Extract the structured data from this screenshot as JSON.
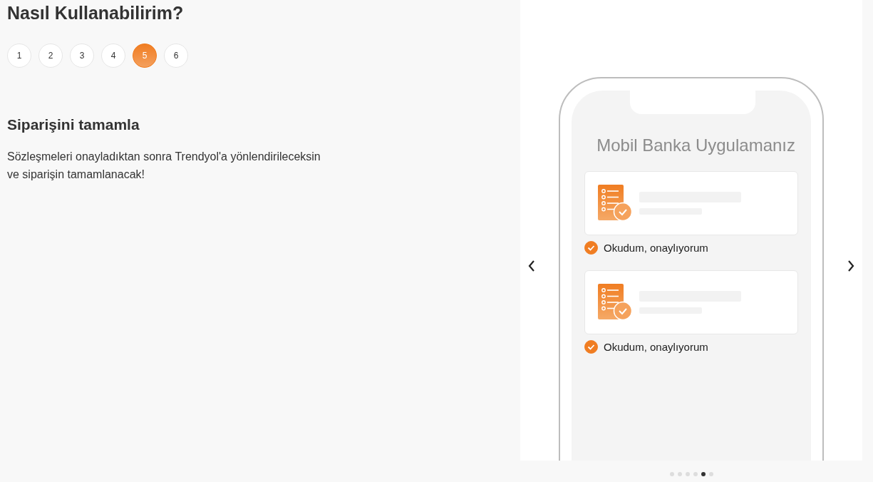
{
  "title": "Nasıl Kullanabilirim?",
  "steps": [
    {
      "label": "1",
      "selected": false
    },
    {
      "label": "2",
      "selected": false
    },
    {
      "label": "3",
      "selected": false
    },
    {
      "label": "4",
      "selected": false
    },
    {
      "label": "5",
      "selected": true
    },
    {
      "label": "6",
      "selected": false
    }
  ],
  "step": {
    "title": "Siparişini tamamla",
    "description": "Sözleşmeleri onayladıktan sonra Trendyol'a yönlendirileceksin\nve siparişin tamamlanacak!"
  },
  "slide": {
    "app_title": "Mobil Banka Uygulamanız",
    "agreements": [
      {
        "label": "Okudum, onaylıyorum",
        "checked": true
      },
      {
        "label": "Okudum, onaylıyorum",
        "checked": true
      }
    ]
  },
  "slide_dots": [
    {
      "selected": false
    },
    {
      "selected": false
    },
    {
      "selected": false
    },
    {
      "selected": false
    },
    {
      "selected": true
    },
    {
      "selected": false
    }
  ]
}
